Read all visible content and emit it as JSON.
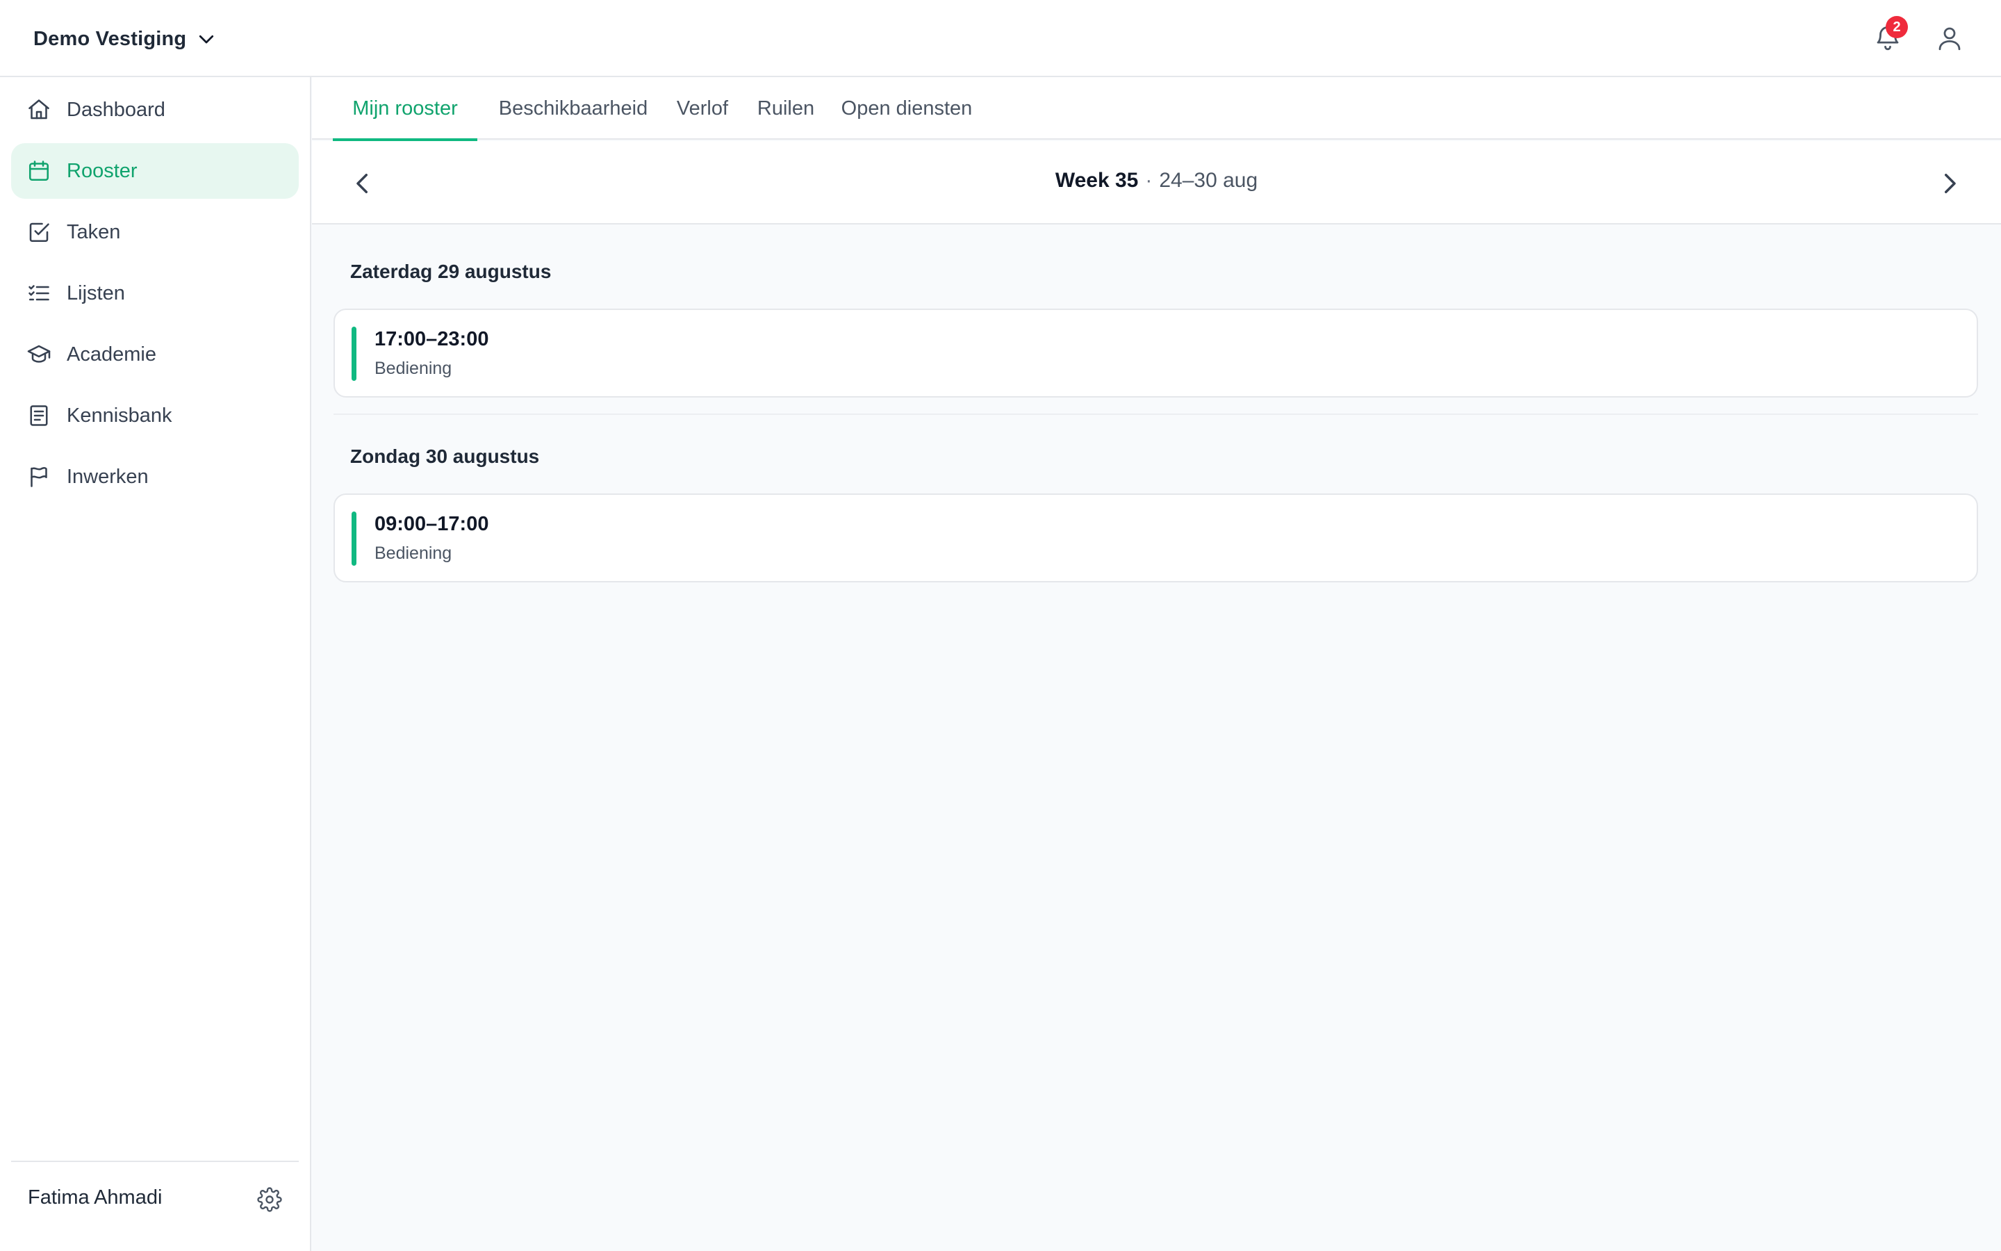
{
  "header": {
    "org_name": "Demo Vestiging",
    "notifications_count": "2",
    "icons": [
      "chevron-down-icon",
      "bell-icon",
      "user-icon"
    ]
  },
  "sidebar": {
    "items": [
      {
        "label": "Dashboard",
        "icon": "home-icon",
        "active": false
      },
      {
        "label": "Rooster",
        "icon": "calendar-icon",
        "active": true
      },
      {
        "label": "Taken",
        "icon": "checkbox-icon",
        "active": false
      },
      {
        "label": "Lijsten",
        "icon": "list-icon",
        "active": false
      },
      {
        "label": "Academie",
        "icon": "graduation-cap-icon",
        "active": false
      },
      {
        "label": "Kennisbank",
        "icon": "book-icon",
        "active": false
      },
      {
        "label": "Inwerken",
        "icon": "flag-icon",
        "active": false
      }
    ],
    "user_name": "Fatima Ahmadi",
    "settings_icon": "gear-icon"
  },
  "tabs": [
    {
      "label": "Mijn rooster",
      "active": true
    },
    {
      "label": "Beschikbaarheid",
      "active": false
    },
    {
      "label": "Verlof",
      "active": false
    },
    {
      "label": "Ruilen",
      "active": false
    },
    {
      "label": "Open diensten",
      "active": false
    }
  ],
  "week": {
    "label": "Week 35",
    "separator": "·",
    "range": "24–30 aug"
  },
  "schedule": [
    {
      "day": "Zaterdag 29 augustus",
      "shifts": [
        {
          "time": "17:00–23:00",
          "role": "Bediening"
        }
      ]
    },
    {
      "day": "Zondag 30 augustus",
      "shifts": [
        {
          "time": "09:00–17:00",
          "role": "Bediening"
        }
      ]
    }
  ],
  "colors": {
    "accent": "#10b981",
    "accent_text": "#10a36d",
    "active_bg": "#e7f7f0",
    "badge": "#ef2b3c",
    "background": "#f8fafc"
  }
}
